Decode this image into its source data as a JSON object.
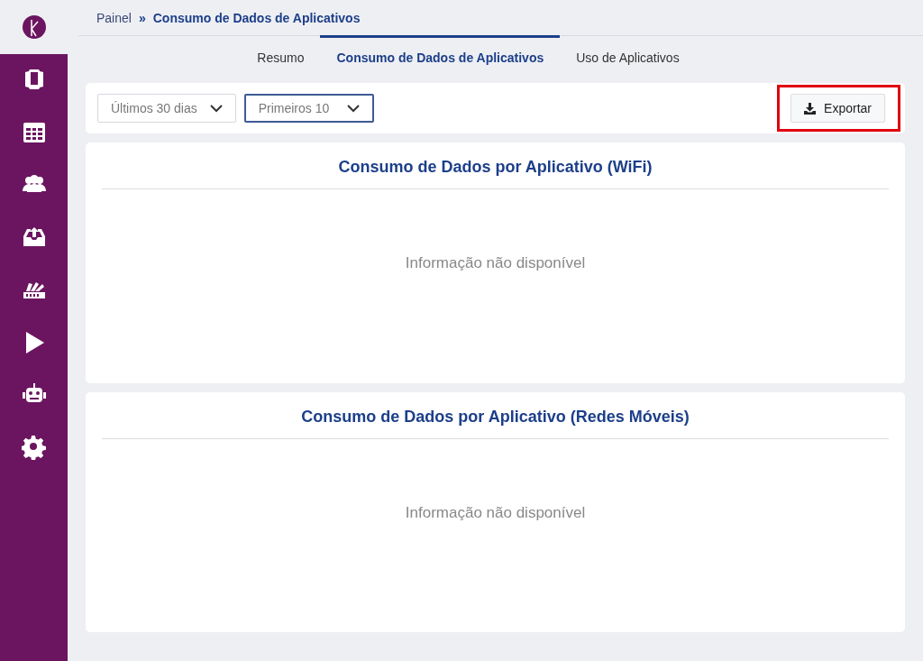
{
  "breadcrumb": {
    "parent": "Painel",
    "separator": "»",
    "current": "Consumo de Dados de Aplicativos"
  },
  "tabs": [
    {
      "label": "Resumo",
      "selected": false
    },
    {
      "label": "Consumo de Dados de Aplicativos",
      "selected": true
    },
    {
      "label": "Uso de Aplicativos",
      "selected": false
    }
  ],
  "filters": [
    {
      "value": "Últimos 30 dias",
      "focused": false
    },
    {
      "value": "Primeiros 10",
      "focused": true
    }
  ],
  "export_button": {
    "label": "Exportar",
    "highlighted": true
  },
  "panels": [
    {
      "title": "Consumo de Dados por Aplicativo (WiFi)",
      "message": "Informação não disponível"
    },
    {
      "title": "Consumo de Dados por Aplicativo (Redes Móveis)",
      "message": "Informação não disponível"
    }
  ]
}
